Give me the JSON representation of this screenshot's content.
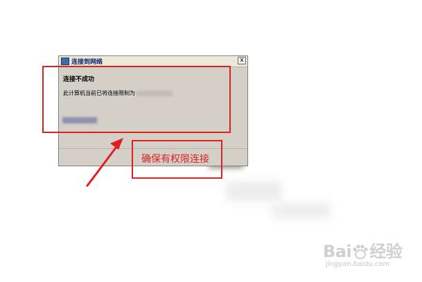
{
  "dialog": {
    "title": "连接到网络",
    "close_label": "x",
    "heading": "连接不成功",
    "message": "此计算机当前已将连接限制为"
  },
  "annotation": {
    "label": "确保有权限连接",
    "color": "#e02020"
  },
  "watermark": {
    "brand": "Bai",
    "brand_suffix": "经验",
    "url": "jingyan.baidu.com"
  }
}
